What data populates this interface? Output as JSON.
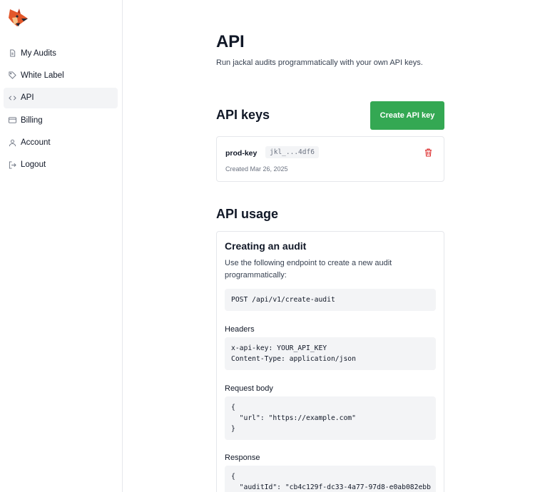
{
  "sidebar": {
    "items": [
      {
        "label": "My Audits",
        "icon": "document-icon"
      },
      {
        "label": "White Label",
        "icon": "tag-icon"
      },
      {
        "label": "API",
        "icon": "code-icon",
        "active": true
      },
      {
        "label": "Billing",
        "icon": "credit-card-icon"
      },
      {
        "label": "Account",
        "icon": "user-icon"
      },
      {
        "label": "Logout",
        "icon": "logout-icon"
      }
    ]
  },
  "page": {
    "title": "API",
    "subtitle": "Run jackal audits programmatically with your own API keys."
  },
  "keys": {
    "title": "API keys",
    "create_label": "Create API key",
    "items": [
      {
        "name": "prod-key",
        "masked": "jkl_...4df6",
        "created": "Created Mar 26, 2025"
      }
    ]
  },
  "usage": {
    "title": "API usage",
    "heading": "Creating an audit",
    "description": "Use the following endpoint to create a new audit programmatically:",
    "endpoint": "POST /api/v1/create-audit",
    "headers_label": "Headers",
    "headers_code": "x-api-key: YOUR_API_KEY\nContent-Type: application/json",
    "body_label": "Request body",
    "body_code": "{\n  \"url\": \"https://example.com\"\n}",
    "response_label": "Response",
    "response_code": "{\n  \"auditId\": \"cb4c129f-dc33-4a77-97d8-e0ab082ebb"
  },
  "colors": {
    "accent_button": "#34a853",
    "danger": "#dc2626",
    "active_nav_bg": "#f3f4f6",
    "code_bg": "#f3f4f6"
  }
}
